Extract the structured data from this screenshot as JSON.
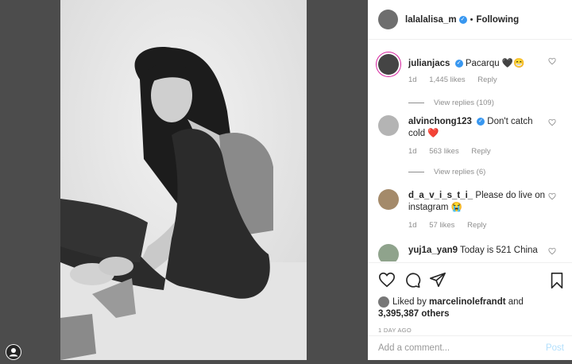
{
  "header": {
    "username": "lalalalisa_m",
    "separator": "•",
    "follow_status": "Following"
  },
  "comments": [
    {
      "user": "julianjacs",
      "verified": true,
      "text": "Pacarqu 🖤😁",
      "time": "1d",
      "likes": "1,445 likes",
      "reply": "Reply",
      "view_replies": "View replies (109)"
    },
    {
      "user": "alvinchong123",
      "verified": true,
      "text": "Don't catch cold ❤️",
      "time": "1d",
      "likes": "563 likes",
      "reply": "Reply",
      "view_replies": "View replies (6)"
    },
    {
      "user": "d_a_v_i_s_t_i_",
      "verified": false,
      "text": "Please do live on instagram 😭",
      "time": "1d",
      "likes": "57 likes",
      "reply": "Reply"
    },
    {
      "user": "yuj1a_yan9",
      "verified": false,
      "text": "Today is 521 China"
    }
  ],
  "post": {
    "liked_by_prefix": "Liked by",
    "liked_by_user": "marcelinolefrandt",
    "liked_by_and": "and",
    "others_count": "3,395,387 others",
    "timestamp": "1 DAY AGO"
  },
  "add_comment": {
    "placeholder": "Add a comment...",
    "post_label": "Post"
  },
  "colors": {
    "accent": "#3897f0",
    "post_disabled": "#b2dffc",
    "muted": "#8e8e8e"
  }
}
